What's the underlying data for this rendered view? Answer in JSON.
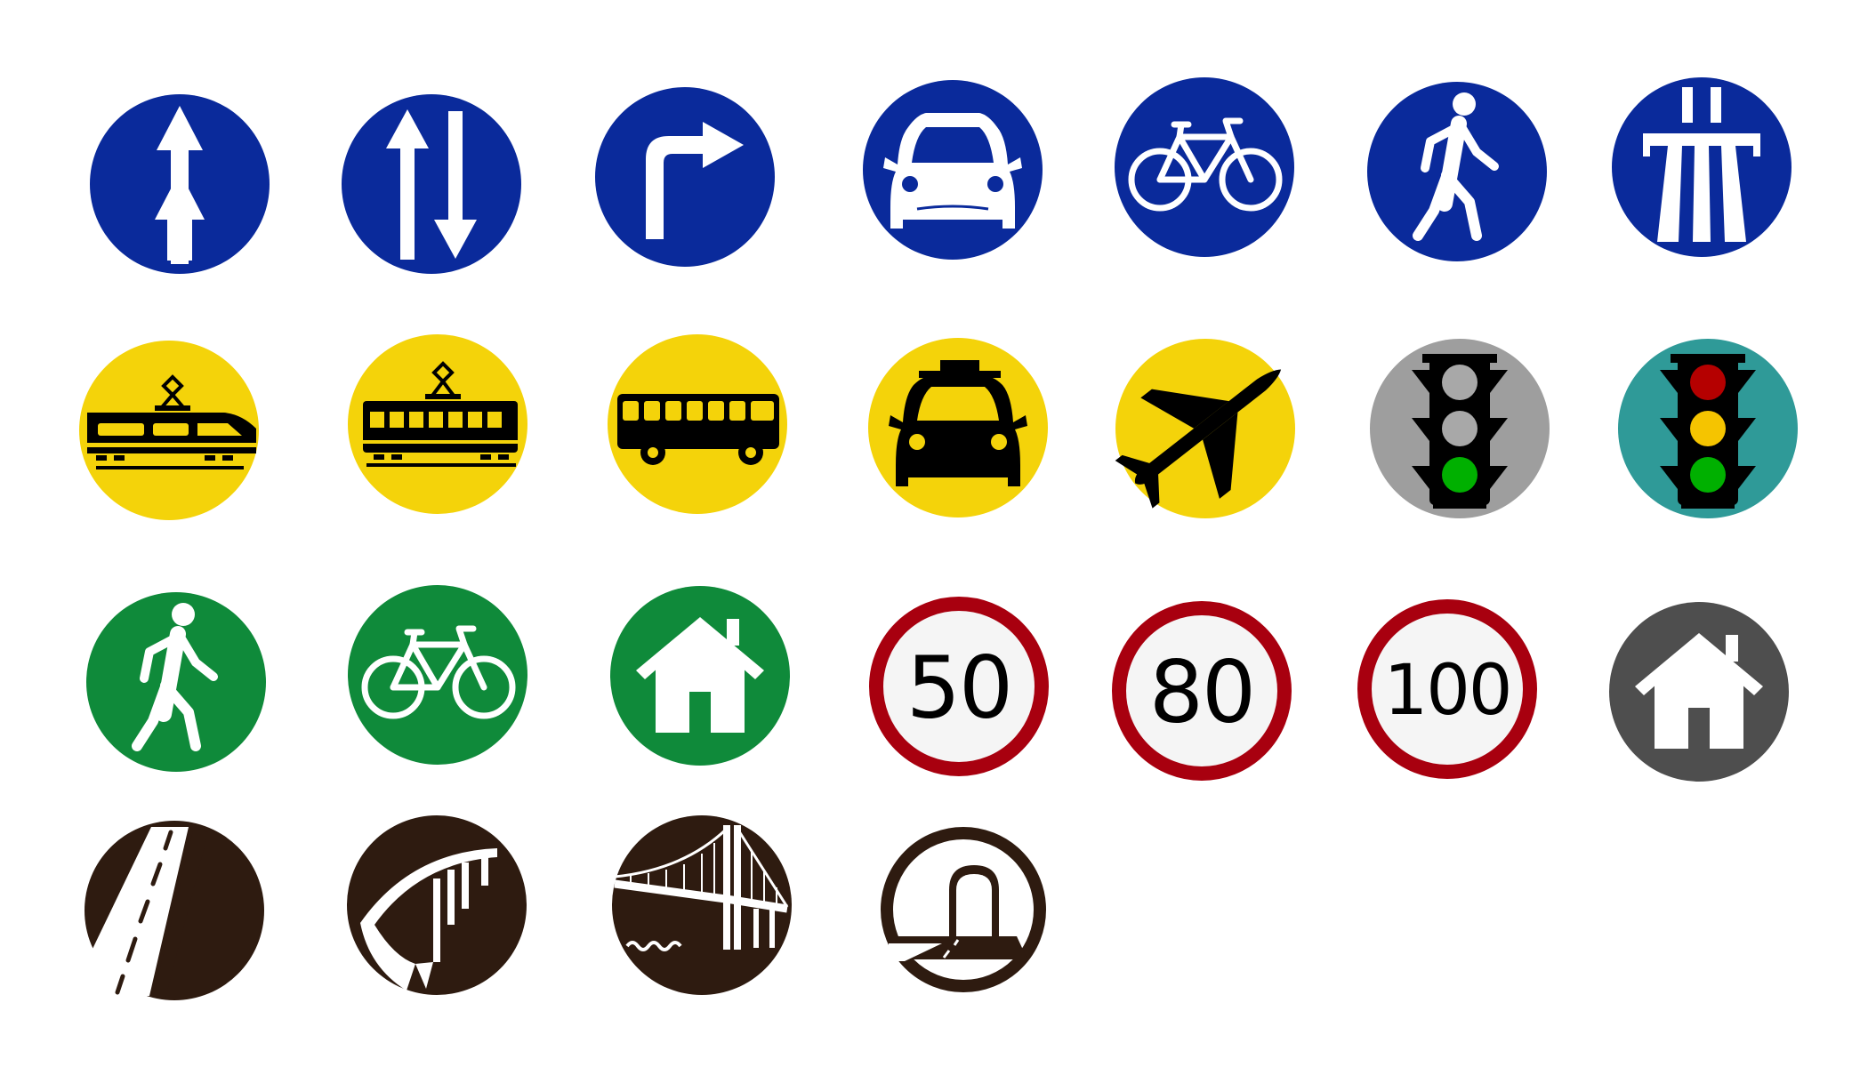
{
  "colors": {
    "blue": "#0A2A9B",
    "yellow": "#F4D30A",
    "green": "#0F8A3A",
    "gray_light": "#9E9E9E",
    "teal": "#2F9A98",
    "dark_gray": "#4E4E4E",
    "brown": "#2E1B10",
    "speed_red": "#A8000F",
    "speed_face": "#F5F5F5",
    "white": "#FFFFFF",
    "black": "#000000",
    "light_red": "#B50000",
    "light_yellow": "#F5C400",
    "light_green": "#00B000",
    "light_off": "#A8A8A8"
  },
  "signs": [
    {
      "name": "one-way-ahead-sign",
      "icon": "arrow-up-icon",
      "bg": "blue"
    },
    {
      "name": "two-way-traffic-sign",
      "icon": "two-way-arrows-icon",
      "bg": "blue"
    },
    {
      "name": "turn-right-sign",
      "icon": "turn-right-arrow-icon",
      "bg": "blue"
    },
    {
      "name": "car-sign",
      "icon": "car-icon",
      "bg": "blue"
    },
    {
      "name": "bicycle-path-sign",
      "icon": "bicycle-icon",
      "bg": "blue"
    },
    {
      "name": "pedestrian-path-sign",
      "icon": "pedestrian-icon",
      "bg": "blue"
    },
    {
      "name": "motorway-sign",
      "icon": "motorway-icon",
      "bg": "blue"
    },
    {
      "name": "train-sign",
      "icon": "train-icon",
      "bg": "yellow"
    },
    {
      "name": "tram-sign",
      "icon": "tram-icon",
      "bg": "yellow"
    },
    {
      "name": "bus-sign",
      "icon": "bus-icon",
      "bg": "yellow"
    },
    {
      "name": "taxi-sign",
      "icon": "taxi-icon",
      "bg": "yellow"
    },
    {
      "name": "airport-sign",
      "icon": "airplane-icon",
      "bg": "yellow"
    },
    {
      "name": "traffic-light-gray-sign",
      "icon": "traffic-light-icon",
      "bg": "gray_light"
    },
    {
      "name": "traffic-light-teal-sign",
      "icon": "traffic-light-icon",
      "bg": "teal"
    },
    {
      "name": "pedestrian-green-sign",
      "icon": "pedestrian-icon",
      "bg": "green"
    },
    {
      "name": "bicycle-green-sign",
      "icon": "bicycle-icon",
      "bg": "green"
    },
    {
      "name": "home-green-sign",
      "icon": "house-icon",
      "bg": "green"
    },
    {
      "name": "speed-limit-50-sign",
      "icon": "speed-limit-icon",
      "value": "50"
    },
    {
      "name": "speed-limit-80-sign",
      "icon": "speed-limit-icon",
      "value": "80"
    },
    {
      "name": "speed-limit-100-sign",
      "icon": "speed-limit-icon",
      "value": "100"
    },
    {
      "name": "home-gray-sign",
      "icon": "house-icon",
      "bg": "dark_gray"
    },
    {
      "name": "road-sign",
      "icon": "road-icon",
      "bg": "brown"
    },
    {
      "name": "arch-bridge-sign",
      "icon": "arch-bridge-icon",
      "bg": "brown"
    },
    {
      "name": "suspension-bridge-sign",
      "icon": "suspension-bridge-icon",
      "bg": "brown"
    },
    {
      "name": "tunnel-sign",
      "icon": "tunnel-icon",
      "bg": "white"
    }
  ]
}
